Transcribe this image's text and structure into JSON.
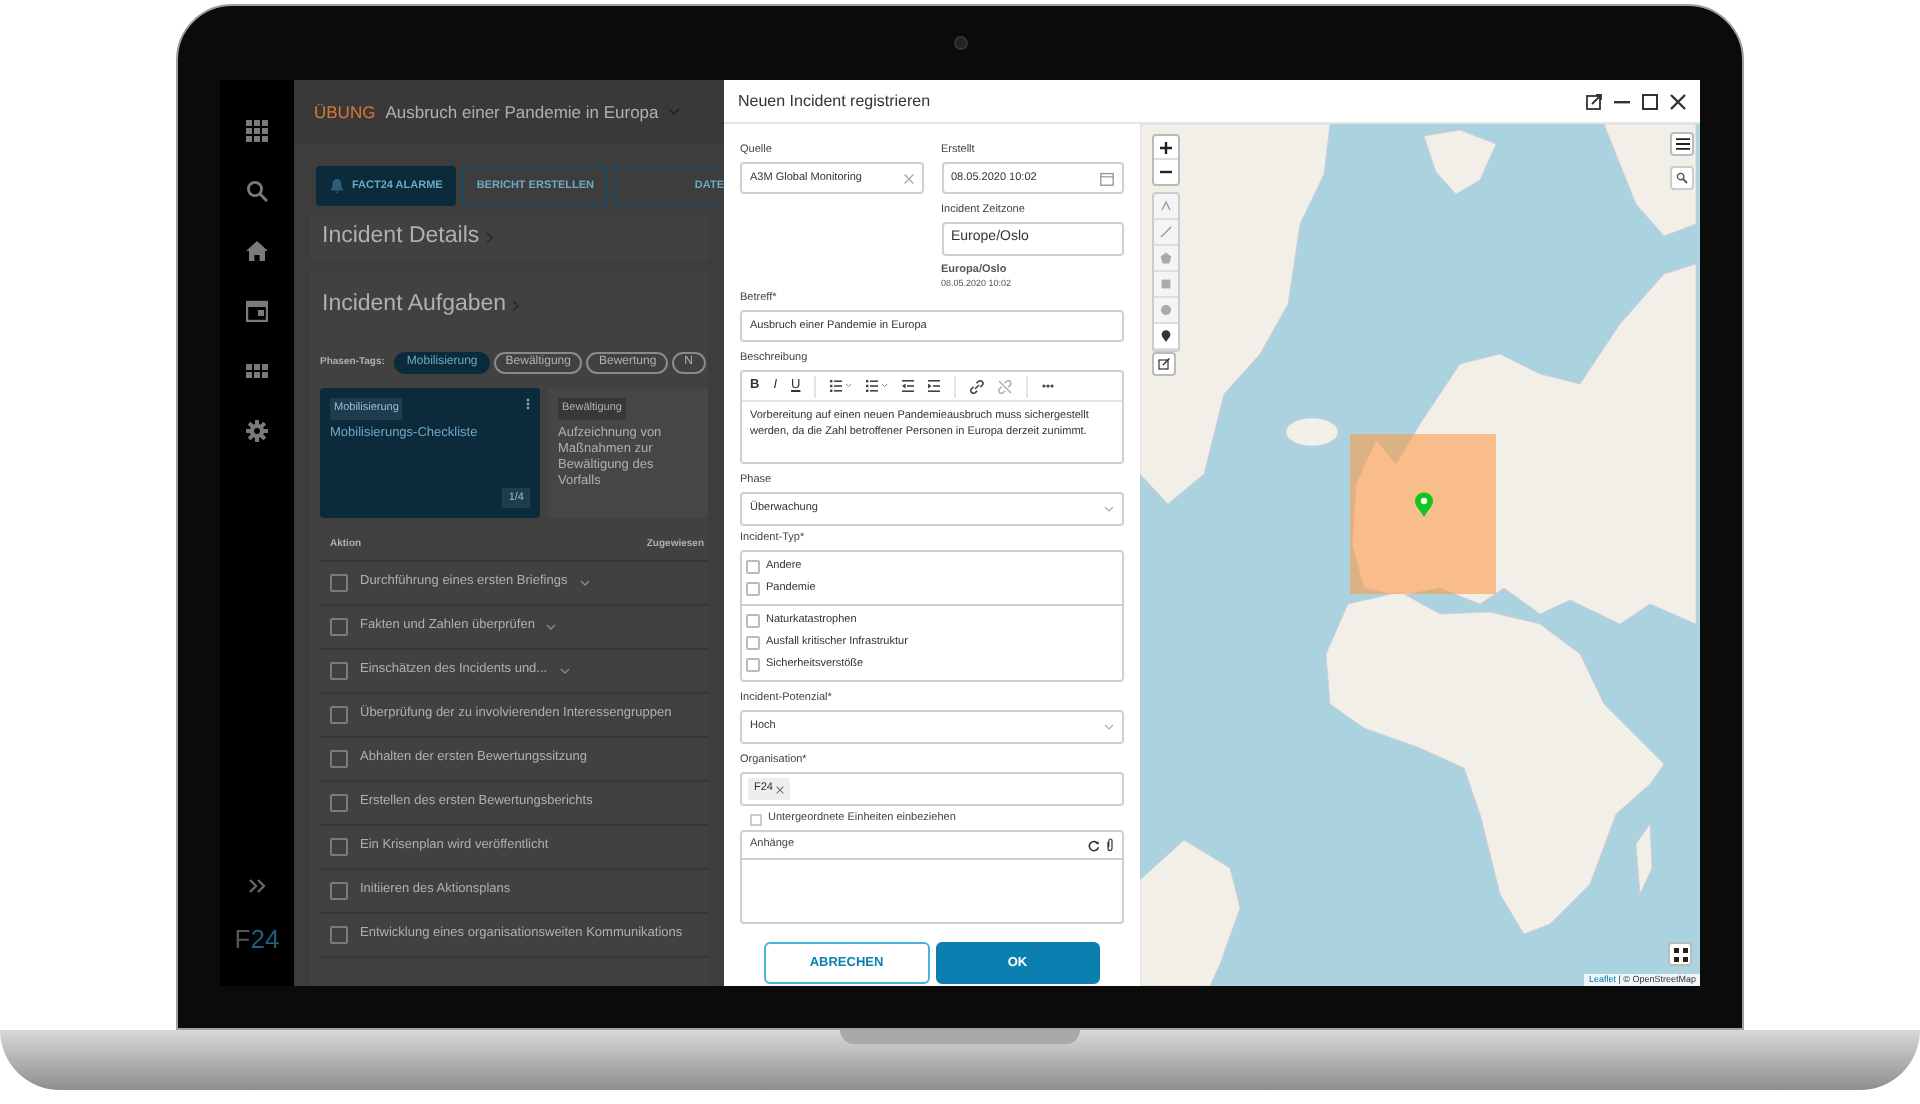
{
  "sidebar": {
    "logo": "F24"
  },
  "incident_header": {
    "badge": "ÜBUNG",
    "title": "Ausbruch einer Pandemie in Europa"
  },
  "actions": [
    {
      "label": "FACT24 ALARME",
      "kind": "primary"
    },
    {
      "label": "BERICHT ERSTELLEN",
      "kind": "outline"
    },
    {
      "label": "DATE",
      "kind": "outline"
    }
  ],
  "incident_details": {
    "title": "Incident Details"
  },
  "tasks": {
    "title": "Incident Aufgaben",
    "phase_label": "Phasen-Tags:",
    "phase_tags": [
      {
        "label": "Mobilisierung",
        "selected": true
      },
      {
        "label": "Bewältigung",
        "selected": false
      },
      {
        "label": "Bewertung",
        "selected": false
      },
      {
        "label": "N",
        "selected": false
      }
    ],
    "cards": [
      {
        "tag": "Mobilisierung",
        "title": "Mobilisierungs-Checkliste",
        "count": "1/4",
        "selected": true
      },
      {
        "tag": "Bewältigung",
        "title": "Aufzeichnung von Maßnahmen zur Bewältigung des Vorfalls",
        "selected": false
      }
    ],
    "columns": [
      "Aktion",
      "Zugewiesen"
    ],
    "rows": [
      {
        "text": "Durchführung eines ersten Briefings",
        "checked": false,
        "expandable": true
      },
      {
        "text": "Fakten und Zahlen überprüfen",
        "checked": false,
        "expandable": true
      },
      {
        "text": "Einschätzen des Incidents und...",
        "checked": false,
        "expandable": true
      },
      {
        "text": "Überprüfung der zu involvierenden Interessengruppen",
        "checked": false,
        "expandable": false
      },
      {
        "text": "Abhalten der ersten Bewertungssitzung",
        "checked": false,
        "expandable": false
      },
      {
        "text": "Erstellen des ersten Bewertungsberichts",
        "checked": false,
        "expandable": false
      },
      {
        "text": "Ein Krisenplan wird veröffentlicht",
        "checked": false,
        "expandable": false
      },
      {
        "text": "Initiieren des Aktionsplans",
        "checked": false,
        "expandable": false
      },
      {
        "text": "Entwicklung eines organisationsweiten Kommunikations",
        "checked": false,
        "expandable": false
      }
    ]
  },
  "dialog": {
    "title": "Neuen Incident registrieren",
    "source": {
      "label": "Quelle",
      "value": "A3M Global Monitoring"
    },
    "created": {
      "label": "Erstellt",
      "value": "08.05.2020 10:02"
    },
    "timezone": {
      "label": "Incident Zeitzone",
      "value": "Europe/Oslo",
      "note": "Europa/Oslo",
      "note_time": "08.05.2020 10:02"
    },
    "subject": {
      "label": "Betreff*",
      "value": "Ausbruch einer Pandemie in Europa"
    },
    "description": {
      "label": "Beschreibung",
      "toolbar": [
        {
          "kind": "bold",
          "label": "B"
        },
        {
          "kind": "italic",
          "label": "I"
        },
        {
          "kind": "underline",
          "label": "U"
        }
      ],
      "text": "Vorbereitung auf einen neuen Pandemieausbruch muss sichergestellt werden, da die Zahl betroffener Personen in Europa derzeit zunimmt."
    },
    "phase": {
      "label": "Phase",
      "value": "Überwachung"
    },
    "incident_type": {
      "label": "Incident-Typ*",
      "groups": [
        [
          {
            "label": "Andere",
            "checked": false
          },
          {
            "label": "Pandemie",
            "checked": false
          }
        ],
        [
          {
            "label": "Naturkatastrophen",
            "checked": false
          },
          {
            "label": "Ausfall kritischer Infrastruktur",
            "checked": false
          },
          {
            "label": "Sicherheitsverstöße",
            "checked": false
          }
        ]
      ]
    },
    "potential": {
      "label": "Incident-Potenzial*",
      "value": "Hoch"
    },
    "organisation": {
      "label": "Organisation*",
      "chips": [
        "F24"
      ]
    },
    "include_sub_units": {
      "label": "Untergeordnete Einheiten einbeziehen",
      "checked": false
    },
    "attachments": {
      "label": "Anhänge"
    },
    "buttons": [
      {
        "label": "ABRECHEN",
        "kind": "secondary"
      },
      {
        "label": "OK",
        "kind": "primary"
      }
    ]
  },
  "map": {
    "attribution": {
      "link": "Leaflet",
      "text": "| © OpenStreetMap"
    }
  }
}
